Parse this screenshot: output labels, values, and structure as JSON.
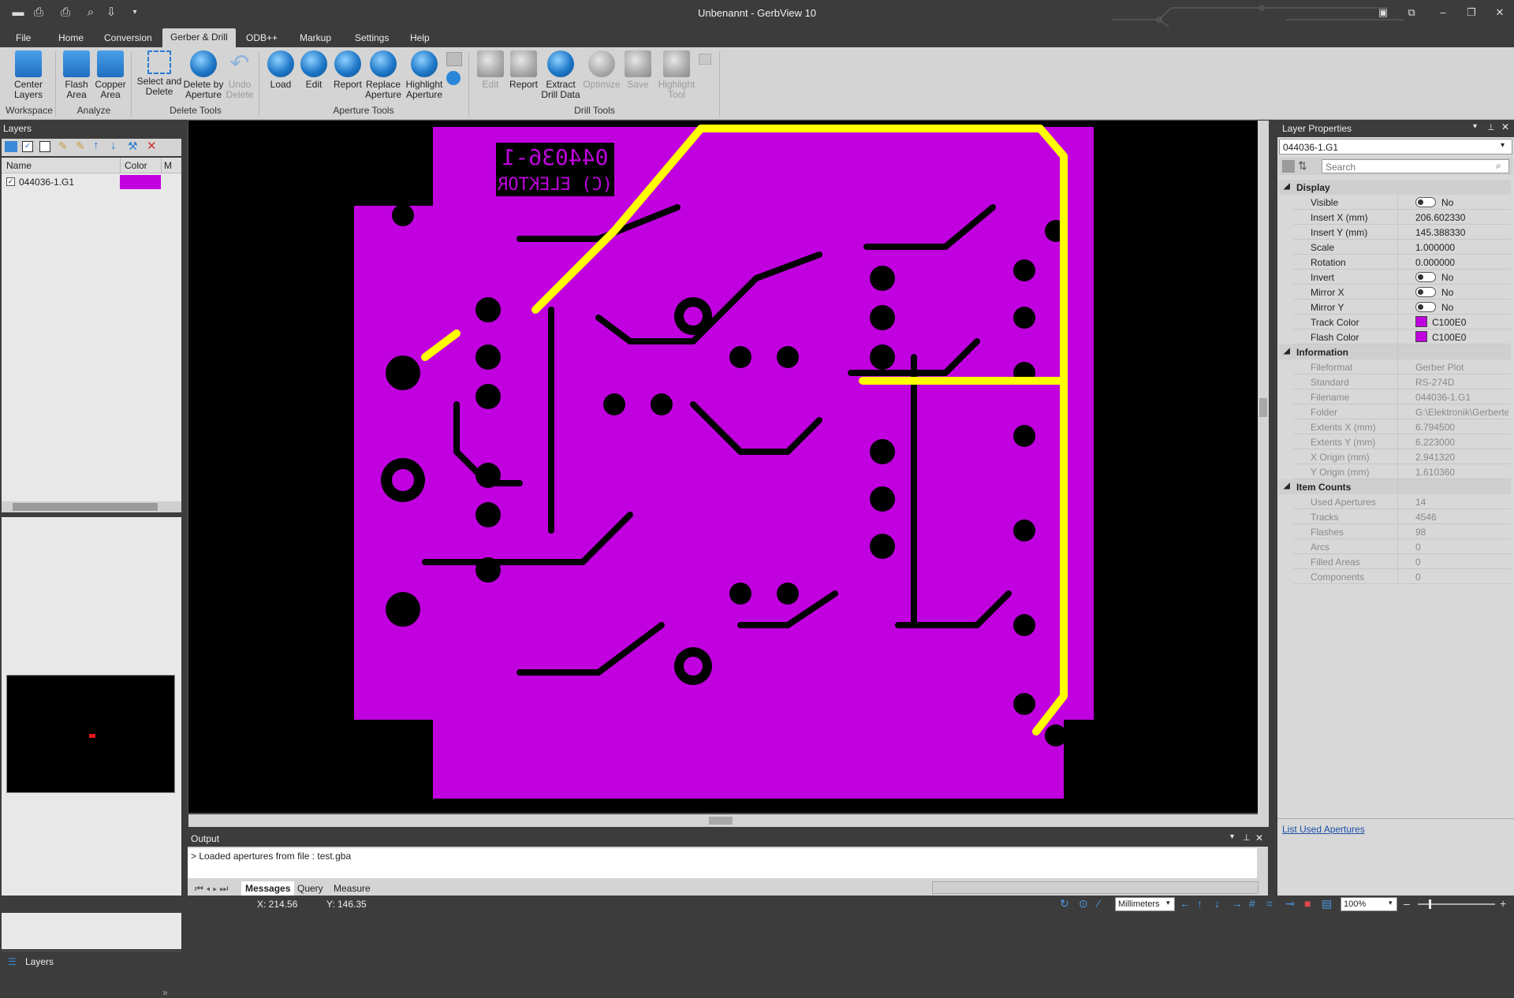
{
  "window": {
    "title": "Unbenannt - GerbView 10"
  },
  "menu": [
    "File",
    "Home",
    "Conversion",
    "Gerber & Drill",
    "ODB++",
    "Markup",
    "Settings",
    "Help"
  ],
  "ribbon": {
    "workspace": {
      "center_layers": "Center\nLayers",
      "group": "Workspace"
    },
    "analyze": {
      "flash_area": "Flash\nArea",
      "copper_area": "Copper\nArea",
      "group": "Analyze"
    },
    "delete_tools": {
      "select_and_delete": "Select and\nDelete",
      "delete_by_aperture": "Delete by\nAperture",
      "undo_delete": "Undo\nDelete",
      "group": "Delete Tools"
    },
    "aperture_tools": {
      "load": "Load",
      "edit": "Edit",
      "report": "Report",
      "replace": "Replace\nAperture",
      "highlight": "Highlight\nAperture",
      "group": "Aperture Tools"
    },
    "drill_tools": {
      "edit": "Edit",
      "report": "Report",
      "extract": "Extract\nDrill Data",
      "optimize": "Optimize",
      "save": "Save",
      "highlight_tool": "Highlight\nTool",
      "group": "Drill Tools"
    }
  },
  "layers_panel": {
    "title": "Layers",
    "columns": [
      "Name",
      "Color",
      "M"
    ],
    "rows": [
      {
        "name": "044036-1.G1",
        "color": "#c100e0",
        "checked": true
      }
    ],
    "bottom_tab": "Layers"
  },
  "pcb": {
    "text_line1": "044036-1",
    "text_line2": "(C) ELEKTOR",
    "layer_color": "#c100e0",
    "highlight_color": "#ffff00"
  },
  "layer_properties": {
    "title": "Layer Properties",
    "selected_layer": "044036-1.G1",
    "search_placeholder": "Search",
    "display_label": "Display",
    "visible": {
      "label": "Visible",
      "value": "No"
    },
    "insert_x": {
      "label": "Insert X (mm)",
      "value": "206.602330"
    },
    "insert_y": {
      "label": "Insert Y (mm)",
      "value": "145.388330"
    },
    "scale": {
      "label": "Scale",
      "value": "1.000000"
    },
    "rotation": {
      "label": "Rotation",
      "value": "0.000000"
    },
    "invert": {
      "label": "Invert",
      "value": "No"
    },
    "mirror_x": {
      "label": "Mirror X",
      "value": "No"
    },
    "mirror_y": {
      "label": "Mirror Y",
      "value": "No"
    },
    "track_color": {
      "label": "Track Color",
      "value": "C100E0",
      "color": "#c100e0"
    },
    "flash_color": {
      "label": "Flash Color",
      "value": "C100E0",
      "color": "#c100e0"
    },
    "information_label": "Information",
    "fileformat": {
      "label": "Fileformat",
      "value": "Gerber Plot"
    },
    "standard": {
      "label": "Standard",
      "value": "RS-274D"
    },
    "filename": {
      "label": "Filename",
      "value": "044036-1.G1"
    },
    "folder": {
      "label": "Folder",
      "value": "G:\\Elektronik\\Gerbertest\\"
    },
    "extents_x": {
      "label": "Extents X (mm)",
      "value": "6.794500"
    },
    "extents_y": {
      "label": "Extents Y (mm)",
      "value": "6.223000"
    },
    "x_origin": {
      "label": "X Origin (mm)",
      "value": "2.941320"
    },
    "y_origin": {
      "label": "Y Origin (mm)",
      "value": "1.610360"
    },
    "item_counts_label": "Item Counts",
    "used_apertures": {
      "label": "Used Apertures",
      "value": "14"
    },
    "tracks": {
      "label": "Tracks",
      "value": "4546"
    },
    "flashes": {
      "label": "Flashes",
      "value": "98"
    },
    "arcs": {
      "label": "Arcs",
      "value": "0"
    },
    "filled_areas": {
      "label": "Filled Areas",
      "value": "0"
    },
    "components": {
      "label": "Components",
      "value": "0"
    },
    "list_link": "List Used Apertures"
  },
  "output": {
    "title": "Output",
    "message": "> Loaded apertures from file : test.gba",
    "tabs": [
      "Messages",
      "Query",
      "Measure"
    ]
  },
  "status": {
    "x": "X: 214.56",
    "y": "Y: 146.35",
    "units": "Millimeters",
    "zoom": "100%"
  }
}
